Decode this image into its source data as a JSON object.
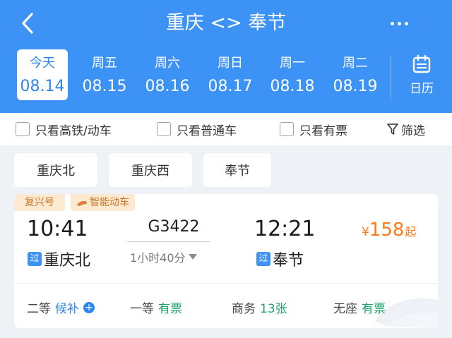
{
  "header": {
    "title": "重庆 <> 奉节",
    "back_icon": "chevron-left-icon",
    "more_icon": "more-dots-icon",
    "calendar_label": "日历"
  },
  "dates": [
    {
      "day": "今天",
      "date": "08.14",
      "active": true
    },
    {
      "day": "周五",
      "date": "08.15",
      "active": false
    },
    {
      "day": "周六",
      "date": "08.16",
      "active": false
    },
    {
      "day": "周日",
      "date": "08.17",
      "active": false
    },
    {
      "day": "周一",
      "date": "08.18",
      "active": false
    },
    {
      "day": "周二",
      "date": "08.19",
      "active": false
    }
  ],
  "filters": {
    "high_speed": "只看高铁/动车",
    "normal": "只看普通车",
    "available": "只看有票",
    "sift": "筛选"
  },
  "stations": [
    "重庆北",
    "重庆西",
    "奉节"
  ],
  "train": {
    "tag1": "复兴号",
    "tag2": "智能动车",
    "depart_time": "10:41",
    "arrive_time": "12:21",
    "number": "G3422",
    "duration": "1小时40分",
    "pass_mark": "过",
    "depart_station": "重庆北",
    "arrive_station": "奉节",
    "price_currency": "¥",
    "price_value": "158",
    "price_suffix": "起",
    "seats": [
      {
        "class": "二等",
        "status": "候补",
        "type": "waitlist"
      },
      {
        "class": "一等",
        "status": "有票",
        "type": "available"
      },
      {
        "class": "商务",
        "status": "13张",
        "type": "available"
      },
      {
        "class": "无座",
        "status": "有票",
        "type": "available"
      }
    ]
  },
  "colors": {
    "brand": "#3d92f5",
    "price": "#ff7a19",
    "available": "#1fa36a",
    "tag_bg": "#fde9cf",
    "tag_text": "#c8782a"
  }
}
